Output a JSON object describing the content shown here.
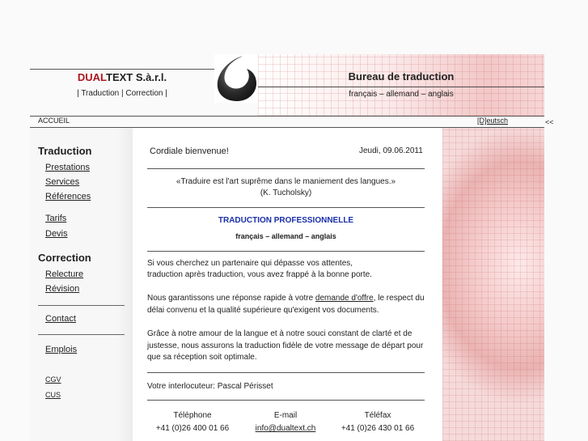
{
  "header": {
    "brand_red": "DUAL",
    "brand_rest": "TEXT S.à.r.l.",
    "brand_sub": "| Traduction | Correction |",
    "bureau": "Bureau de traduction",
    "languages": "français – allemand – anglais"
  },
  "nav": {
    "accueil": "ACCUEIL",
    "deutsch": "[D]eutsch",
    "back": "<<"
  },
  "sidebar": {
    "traduction_heading": "Traduction",
    "prestations": "Prestations",
    "services": "Services",
    "references": "Références",
    "tarifs": "Tarifs",
    "devis": "Devis",
    "correction_heading": "Correction",
    "relecture": "Relecture",
    "revision": "Révision",
    "contact": "Contact",
    "emplois": "Emplois",
    "cgv": "CGV",
    "cus": "CUS"
  },
  "main": {
    "welcome": "Cordiale bienvenue!",
    "date": "Jeudi, 09.06.2011",
    "quote": "«Traduire est l'art suprême dans le maniement des langues.»",
    "quote_author": "(K. Tucholsky)",
    "headline": "TRADUCTION PROFESSIONNELLE",
    "headline_langs": "français – allemand – anglais",
    "p1_line1": "Si vous cherchez un partenaire qui dépasse vos attentes,",
    "p1_line2": "traduction après traduction, vous avez frappé à la bonne porte.",
    "p2_before": "Nous garantissons une réponse rapide à votre ",
    "p2_link": "demande d'offre",
    "p2_after": ", le respect du",
    "p2_line2": "délai convenu et la qualité supérieure qu'exigent vos documents.",
    "p3_line1": "Grâce à notre amour de la langue et à notre souci constant de clarté et de",
    "p3_line2": "justesse, nous assurons la traduction fidèle de votre message de départ pour",
    "p3_line3": "que sa réception soit optimale.",
    "contact_person": "Votre interlocuteur: Pascal Périsset",
    "tel_label": "Téléphone",
    "tel_value": "+41 (0)26 400 01 66",
    "email_label": "E-mail",
    "email_value": "info@dualtext.ch",
    "fax_label": "Téléfax",
    "fax_value": "+41 (0)26 430 01 66"
  },
  "colors": {
    "brand_red": "#b0141c",
    "headline_blue": "#1a2fa8",
    "photo_tint": "#f2c8c8"
  }
}
